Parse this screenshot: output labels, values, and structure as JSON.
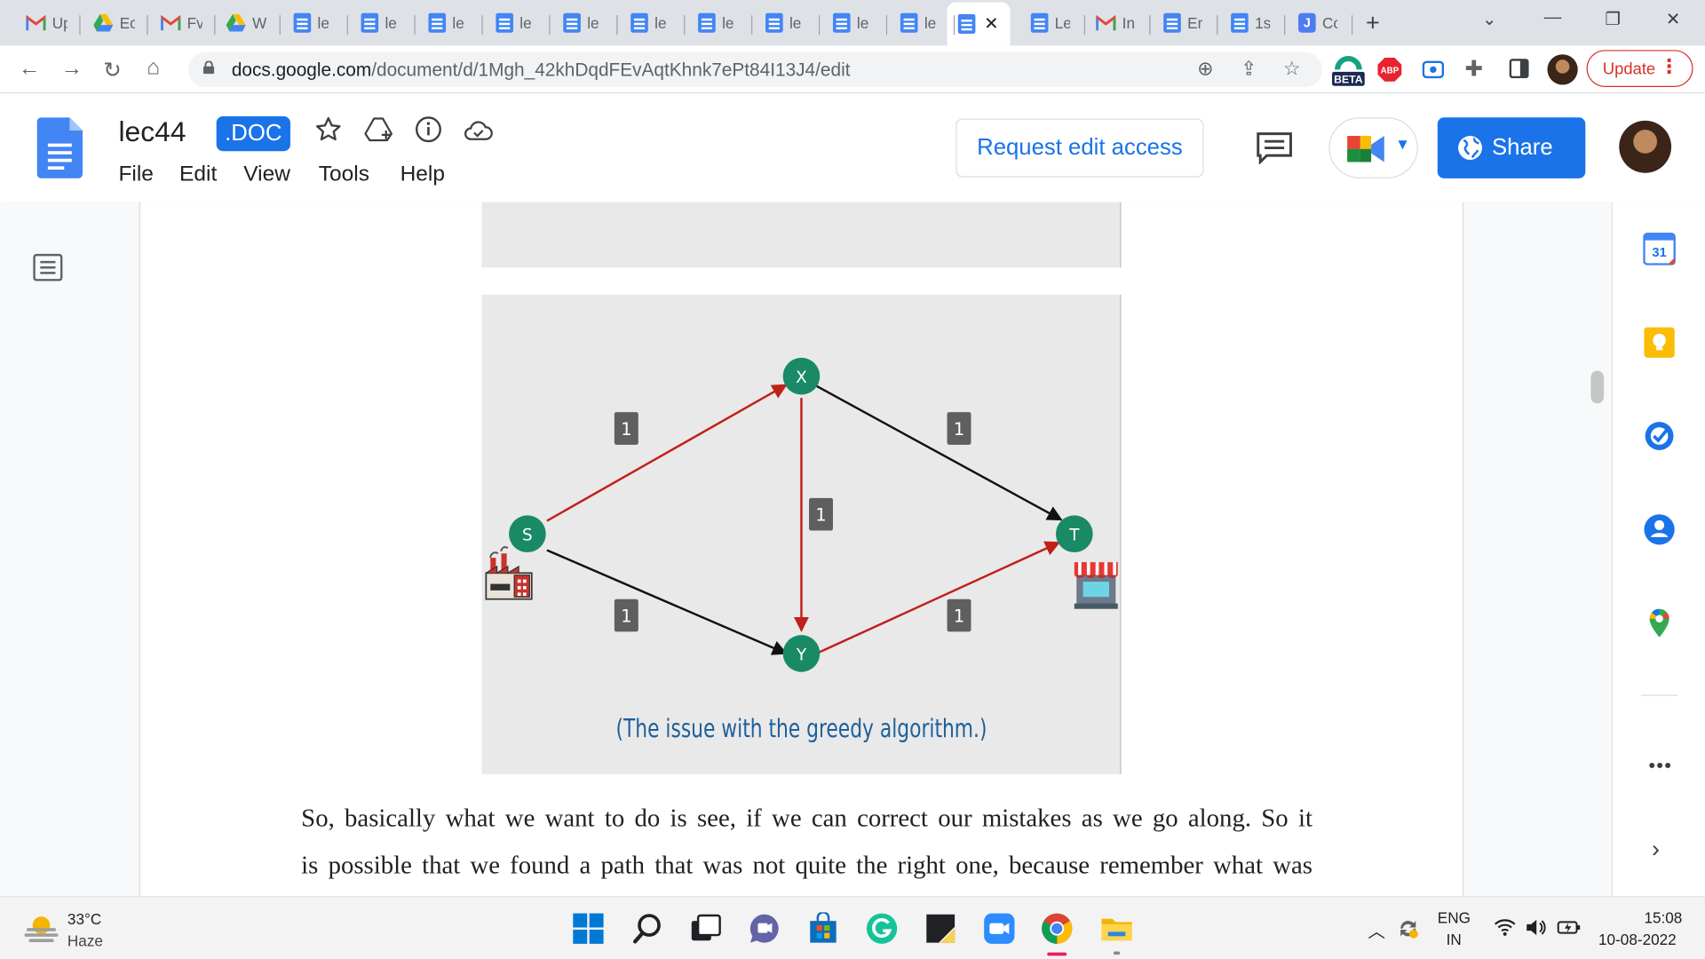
{
  "browser": {
    "tabs": [
      {
        "icon": "gmail",
        "label": "Up"
      },
      {
        "icon": "drive",
        "label": "Ec"
      },
      {
        "icon": "gmail",
        "label": "Fv"
      },
      {
        "icon": "drive",
        "label": "W"
      },
      {
        "icon": "doc",
        "label": "le"
      },
      {
        "icon": "doc",
        "label": "le"
      },
      {
        "icon": "doc",
        "label": "le"
      },
      {
        "icon": "doc",
        "label": "le"
      },
      {
        "icon": "doc",
        "label": "le"
      },
      {
        "icon": "doc",
        "label": "le"
      },
      {
        "icon": "doc",
        "label": "le"
      },
      {
        "icon": "doc",
        "label": "le"
      },
      {
        "icon": "doc",
        "label": "le"
      },
      {
        "icon": "doc",
        "label": "le"
      },
      {
        "icon": "doc",
        "label": "",
        "active": true
      },
      {
        "icon": "doc",
        "label": "Le"
      },
      {
        "icon": "gmail",
        "label": "In"
      },
      {
        "icon": "doc",
        "label": "Er"
      },
      {
        "icon": "doc",
        "label": "1s"
      },
      {
        "icon": "j",
        "label": "Cc"
      }
    ],
    "url_host": "docs.google.com",
    "url_path": "/document/d/1Mgh_42khDqdFEvAqtKhnk7ePt84I13J4/edit",
    "update_label": "Update",
    "beta_label": "BETA",
    "abp_label": "ABP"
  },
  "docs": {
    "title": "lec44",
    "badge": ".DOC",
    "menu": [
      "File",
      "Edit",
      "View",
      "Tools",
      "Help"
    ],
    "request_edit_label": "Request edit access",
    "share_label": "Share",
    "calendar_day": "31"
  },
  "figure": {
    "nodes": [
      "S",
      "X",
      "Y",
      "T"
    ],
    "edge_weight": "1",
    "caption": "(The issue with the greedy algorithm.)",
    "highlight_color": "#c0201a",
    "node_color": "#1a8a66"
  },
  "body_text": {
    "line1": "So, basically what we want to do is see, if we can correct our mistakes as we go along. So it",
    "line2": "is possible that we found a path that was not quite the right one, because remember what was"
  },
  "taskbar": {
    "temperature": "33°C",
    "condition": "Haze",
    "language": "ENG",
    "region": "IN",
    "time": "15:08",
    "date": "10-08-2022"
  }
}
